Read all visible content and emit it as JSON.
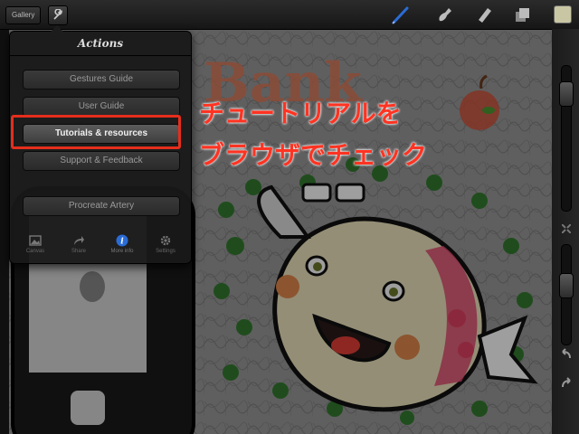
{
  "toolbar": {
    "gallery_label": "Gallery",
    "icons": [
      "wrench-icon",
      "brush-icon",
      "smudge-icon",
      "eraser-icon",
      "layers-icon"
    ],
    "current_color": "#c9c7a3"
  },
  "canvas": {
    "drawing_text": "Bank"
  },
  "actions_popover": {
    "title": "Actions",
    "items": [
      {
        "label": "Gestures Guide",
        "selected": false
      },
      {
        "label": "User Guide",
        "selected": false
      },
      {
        "label": "Tutorials & resources",
        "selected": true
      },
      {
        "label": "Support & Feedback",
        "selected": false
      },
      {
        "label": "Procreate Artery",
        "selected": false
      }
    ],
    "tabs": [
      {
        "label": "Canvas",
        "icon": "image-icon"
      },
      {
        "label": "Share",
        "icon": "share-arrow-icon"
      },
      {
        "label": "More info",
        "icon": "info-icon",
        "active": true
      },
      {
        "label": "Settings",
        "icon": "gear-icon"
      }
    ]
  },
  "annotation": {
    "line1": "チュートリアルを",
    "line2": "ブラウザでチェック",
    "color": "#ff3322"
  },
  "colors": {
    "highlight": "#e52e1c",
    "accent_blue": "#2a6cd6"
  }
}
